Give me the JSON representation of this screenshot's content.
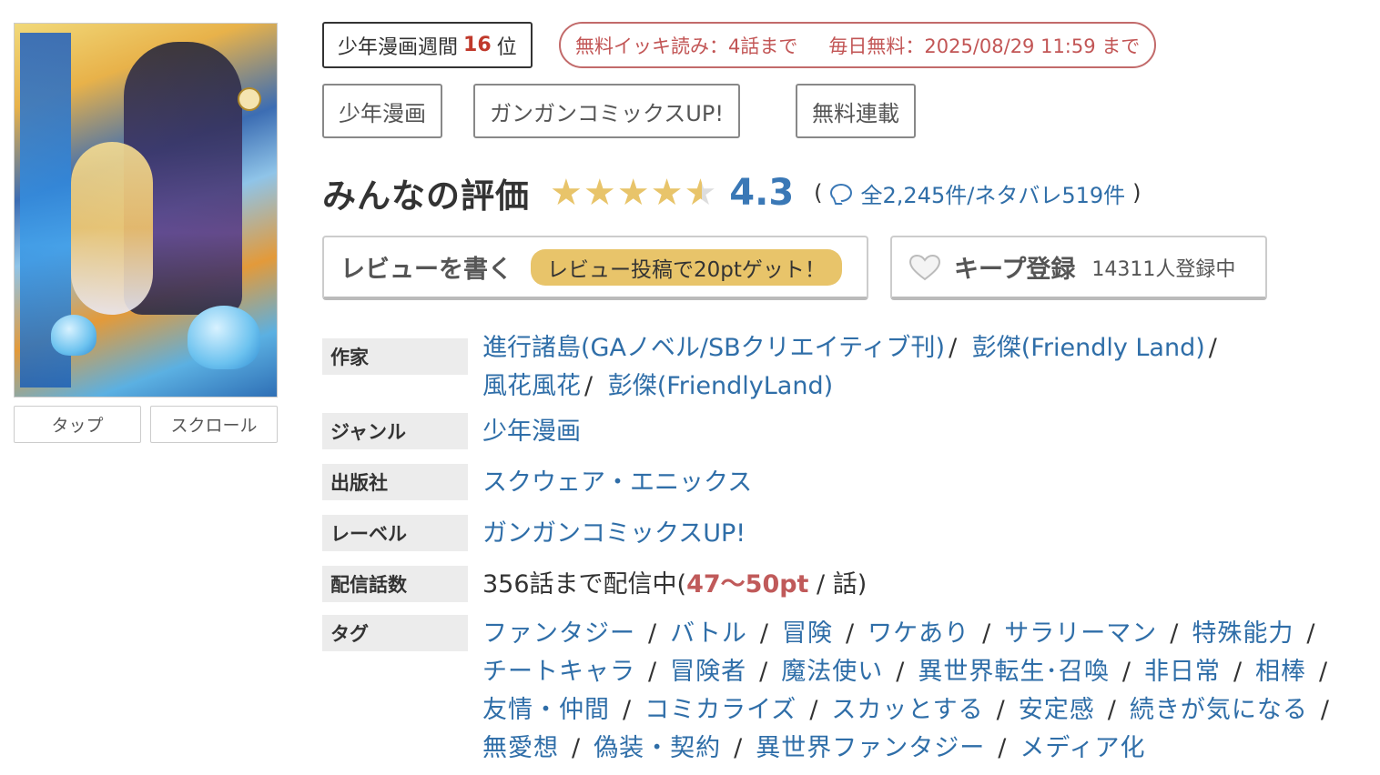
{
  "cover": {
    "buttons": [
      "タップ",
      "スクロール"
    ]
  },
  "rank": {
    "prefix": "少年漫画週間",
    "number": "16",
    "suffix": "位"
  },
  "free_badge": {
    "part1": "無料イッキ読み：4話まで",
    "part2": "毎日無料：2025/08/29 11:59 まで"
  },
  "category_tags": [
    "少年漫画",
    "ガンガンコミックスUP!",
    "無料連載"
  ],
  "rating": {
    "title": "みんなの評価",
    "stars_value": 4.3,
    "score": "4.3",
    "counts": "全2,245件/ネタバレ519件",
    "open_paren": "(",
    "close_paren": ")"
  },
  "review_button": {
    "label": "レビューを書く",
    "pill": "レビュー投稿で20ptゲット！"
  },
  "keep_button": {
    "label": "キープ登録",
    "count": "14311人登録中"
  },
  "info": {
    "author_label": "作家",
    "authors": [
      "進行諸島(GAノベル/SBクリエイティブ刊)",
      "彭傑(Friendly Land)",
      "風花風花",
      "彭傑(FriendlyLand)"
    ],
    "genre_label": "ジャンル",
    "genre": "少年漫画",
    "publisher_label": "出版社",
    "publisher": "スクウェア・エニックス",
    "label_label": "レーベル",
    "label": "ガンガンコミックスUP!",
    "episodes_label": "配信話数",
    "episodes_prefix": "356話まで配信中(",
    "episodes_pt": "47〜50pt",
    "episodes_suffix": " / 話)",
    "tags_label": "タグ",
    "tags": [
      "ファンタジー",
      "バトル",
      "冒険",
      "ワケあり",
      "サラリーマン",
      "特殊能力",
      "チートキャラ",
      "冒険者",
      "魔法使い",
      "異世界転生･召喚",
      "非日常",
      "相棒",
      "友情・仲間",
      "コミカライズ",
      "スカッとする",
      "安定感",
      "続きが気になる",
      "無愛想",
      "偽装・契約",
      "異世界ファンタジー",
      "メディア化"
    ]
  },
  "colors": {
    "link": "#2f6ea8",
    "accent_red": "#c0392b",
    "star": "#e8c46a",
    "score": "#3a78b6"
  }
}
